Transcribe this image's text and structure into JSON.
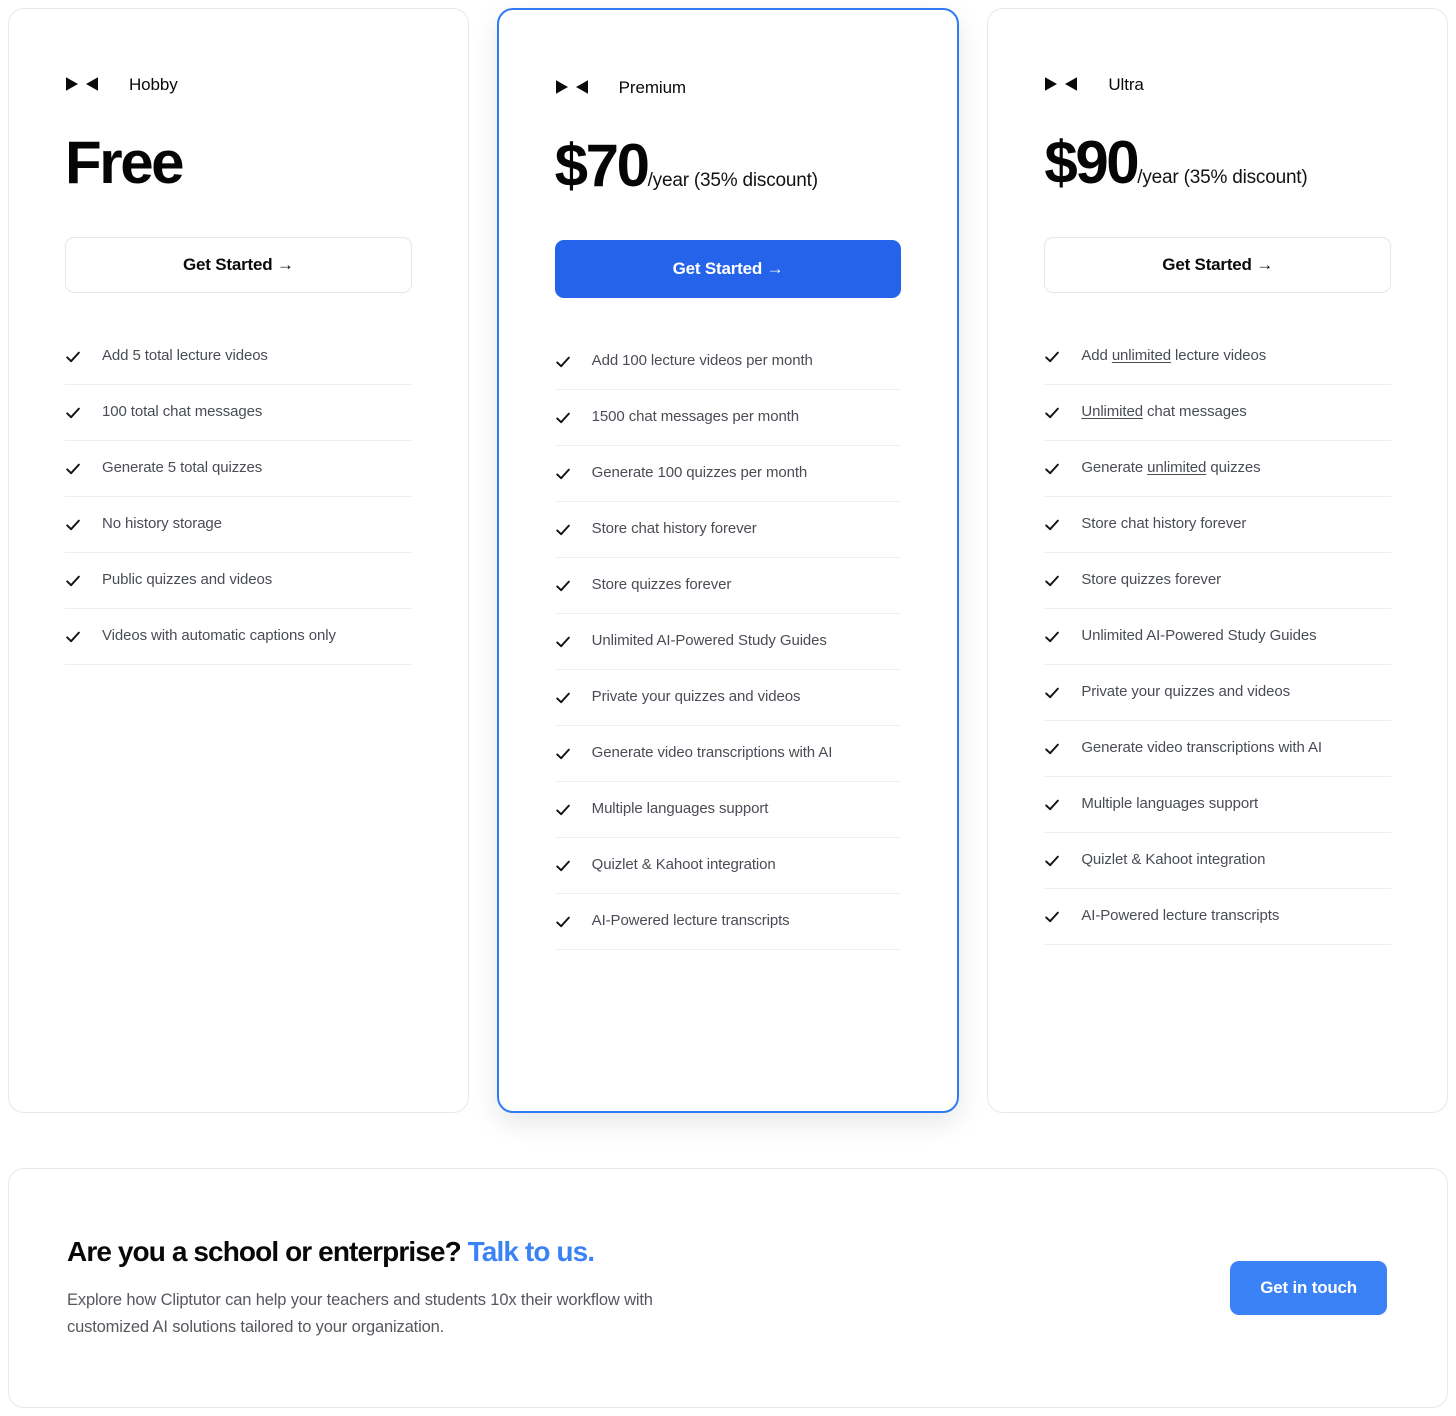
{
  "colors": {
    "featured_border": "#2f7af5",
    "primary_button": "#2563eb",
    "accent_link": "#3b82f6",
    "card_border": "#e7e8ec",
    "divider": "#eceef1",
    "feature_text": "#4a4d55"
  },
  "brand_icon": "play-rewind-icon",
  "check_icon": "check-icon",
  "plans": [
    {
      "name": "Hobby",
      "price": "Free",
      "period": "",
      "featured": false,
      "cta": "Get Started →",
      "features": [
        "Add 5 total lecture videos",
        "100 total chat messages",
        "Generate 5 total quizzes",
        "No history storage",
        "Public quizzes and videos",
        "Videos with automatic captions only"
      ]
    },
    {
      "name": "Premium",
      "price": "$70",
      "period": "/year (35% discount)",
      "featured": true,
      "cta": "Get Started →",
      "features": [
        "Add 100 lecture videos per month",
        "1500 chat messages per month",
        "Generate 100 quizzes per month",
        "Store chat history forever",
        "Store quizzes forever",
        "Unlimited AI-Powered Study Guides",
        "Private your quizzes and videos",
        "Generate video transcriptions with AI",
        "Multiple languages support",
        "Quizlet & Kahoot integration",
        "AI-Powered lecture transcripts"
      ]
    },
    {
      "name": "Ultra",
      "price": "$90",
      "period": "/year (35% discount)",
      "featured": false,
      "cta": "Get Started →",
      "features_html": [
        "Add <u>unlimited</u> lecture videos",
        "<u>Unlimited</u> chat messages",
        "Generate <u>unlimited</u> quizzes",
        "Store chat history forever",
        "Store quizzes forever",
        "Unlimited AI-Powered Study Guides",
        "Private your quizzes and videos",
        "Generate video transcriptions with AI",
        "Multiple languages support",
        "Quizlet & Kahoot integration",
        "AI-Powered lecture transcripts"
      ]
    }
  ],
  "enterprise": {
    "title_plain": "Are you a school or enterprise?",
    "title_link": "Talk to us.",
    "subtitle": "Explore how Cliptutor can help your teachers and students 10x their workflow with customized AI solutions tailored to your organization.",
    "button": "Get in touch"
  }
}
